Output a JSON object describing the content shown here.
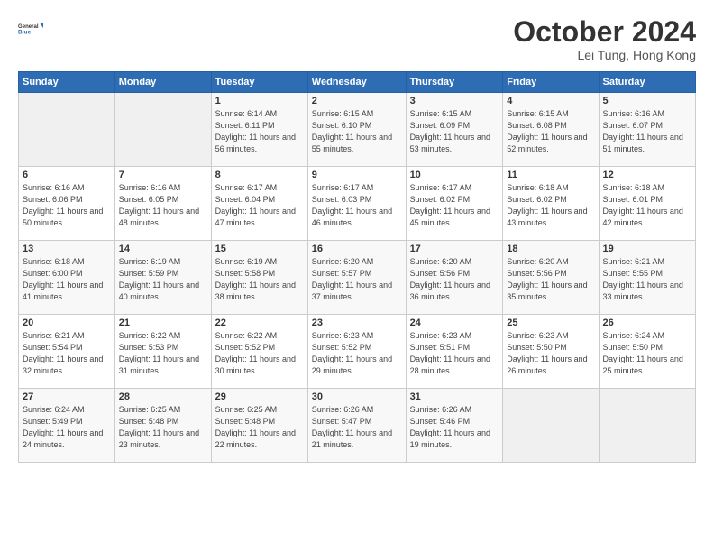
{
  "header": {
    "logo_line1": "General",
    "logo_line2": "Blue",
    "month_title": "October 2024",
    "location": "Lei Tung, Hong Kong"
  },
  "weekdays": [
    "Sunday",
    "Monday",
    "Tuesday",
    "Wednesday",
    "Thursday",
    "Friday",
    "Saturday"
  ],
  "weeks": [
    [
      {
        "day": "",
        "sunrise": "",
        "sunset": "",
        "daylight": ""
      },
      {
        "day": "",
        "sunrise": "",
        "sunset": "",
        "daylight": ""
      },
      {
        "day": "1",
        "sunrise": "Sunrise: 6:14 AM",
        "sunset": "Sunset: 6:11 PM",
        "daylight": "Daylight: 11 hours and 56 minutes."
      },
      {
        "day": "2",
        "sunrise": "Sunrise: 6:15 AM",
        "sunset": "Sunset: 6:10 PM",
        "daylight": "Daylight: 11 hours and 55 minutes."
      },
      {
        "day": "3",
        "sunrise": "Sunrise: 6:15 AM",
        "sunset": "Sunset: 6:09 PM",
        "daylight": "Daylight: 11 hours and 53 minutes."
      },
      {
        "day": "4",
        "sunrise": "Sunrise: 6:15 AM",
        "sunset": "Sunset: 6:08 PM",
        "daylight": "Daylight: 11 hours and 52 minutes."
      },
      {
        "day": "5",
        "sunrise": "Sunrise: 6:16 AM",
        "sunset": "Sunset: 6:07 PM",
        "daylight": "Daylight: 11 hours and 51 minutes."
      }
    ],
    [
      {
        "day": "6",
        "sunrise": "Sunrise: 6:16 AM",
        "sunset": "Sunset: 6:06 PM",
        "daylight": "Daylight: 11 hours and 50 minutes."
      },
      {
        "day": "7",
        "sunrise": "Sunrise: 6:16 AM",
        "sunset": "Sunset: 6:05 PM",
        "daylight": "Daylight: 11 hours and 48 minutes."
      },
      {
        "day": "8",
        "sunrise": "Sunrise: 6:17 AM",
        "sunset": "Sunset: 6:04 PM",
        "daylight": "Daylight: 11 hours and 47 minutes."
      },
      {
        "day": "9",
        "sunrise": "Sunrise: 6:17 AM",
        "sunset": "Sunset: 6:03 PM",
        "daylight": "Daylight: 11 hours and 46 minutes."
      },
      {
        "day": "10",
        "sunrise": "Sunrise: 6:17 AM",
        "sunset": "Sunset: 6:02 PM",
        "daylight": "Daylight: 11 hours and 45 minutes."
      },
      {
        "day": "11",
        "sunrise": "Sunrise: 6:18 AM",
        "sunset": "Sunset: 6:02 PM",
        "daylight": "Daylight: 11 hours and 43 minutes."
      },
      {
        "day": "12",
        "sunrise": "Sunrise: 6:18 AM",
        "sunset": "Sunset: 6:01 PM",
        "daylight": "Daylight: 11 hours and 42 minutes."
      }
    ],
    [
      {
        "day": "13",
        "sunrise": "Sunrise: 6:18 AM",
        "sunset": "Sunset: 6:00 PM",
        "daylight": "Daylight: 11 hours and 41 minutes."
      },
      {
        "day": "14",
        "sunrise": "Sunrise: 6:19 AM",
        "sunset": "Sunset: 5:59 PM",
        "daylight": "Daylight: 11 hours and 40 minutes."
      },
      {
        "day": "15",
        "sunrise": "Sunrise: 6:19 AM",
        "sunset": "Sunset: 5:58 PM",
        "daylight": "Daylight: 11 hours and 38 minutes."
      },
      {
        "day": "16",
        "sunrise": "Sunrise: 6:20 AM",
        "sunset": "Sunset: 5:57 PM",
        "daylight": "Daylight: 11 hours and 37 minutes."
      },
      {
        "day": "17",
        "sunrise": "Sunrise: 6:20 AM",
        "sunset": "Sunset: 5:56 PM",
        "daylight": "Daylight: 11 hours and 36 minutes."
      },
      {
        "day": "18",
        "sunrise": "Sunrise: 6:20 AM",
        "sunset": "Sunset: 5:56 PM",
        "daylight": "Daylight: 11 hours and 35 minutes."
      },
      {
        "day": "19",
        "sunrise": "Sunrise: 6:21 AM",
        "sunset": "Sunset: 5:55 PM",
        "daylight": "Daylight: 11 hours and 33 minutes."
      }
    ],
    [
      {
        "day": "20",
        "sunrise": "Sunrise: 6:21 AM",
        "sunset": "Sunset: 5:54 PM",
        "daylight": "Daylight: 11 hours and 32 minutes."
      },
      {
        "day": "21",
        "sunrise": "Sunrise: 6:22 AM",
        "sunset": "Sunset: 5:53 PM",
        "daylight": "Daylight: 11 hours and 31 minutes."
      },
      {
        "day": "22",
        "sunrise": "Sunrise: 6:22 AM",
        "sunset": "Sunset: 5:52 PM",
        "daylight": "Daylight: 11 hours and 30 minutes."
      },
      {
        "day": "23",
        "sunrise": "Sunrise: 6:23 AM",
        "sunset": "Sunset: 5:52 PM",
        "daylight": "Daylight: 11 hours and 29 minutes."
      },
      {
        "day": "24",
        "sunrise": "Sunrise: 6:23 AM",
        "sunset": "Sunset: 5:51 PM",
        "daylight": "Daylight: 11 hours and 28 minutes."
      },
      {
        "day": "25",
        "sunrise": "Sunrise: 6:23 AM",
        "sunset": "Sunset: 5:50 PM",
        "daylight": "Daylight: 11 hours and 26 minutes."
      },
      {
        "day": "26",
        "sunrise": "Sunrise: 6:24 AM",
        "sunset": "Sunset: 5:50 PM",
        "daylight": "Daylight: 11 hours and 25 minutes."
      }
    ],
    [
      {
        "day": "27",
        "sunrise": "Sunrise: 6:24 AM",
        "sunset": "Sunset: 5:49 PM",
        "daylight": "Daylight: 11 hours and 24 minutes."
      },
      {
        "day": "28",
        "sunrise": "Sunrise: 6:25 AM",
        "sunset": "Sunset: 5:48 PM",
        "daylight": "Daylight: 11 hours and 23 minutes."
      },
      {
        "day": "29",
        "sunrise": "Sunrise: 6:25 AM",
        "sunset": "Sunset: 5:48 PM",
        "daylight": "Daylight: 11 hours and 22 minutes."
      },
      {
        "day": "30",
        "sunrise": "Sunrise: 6:26 AM",
        "sunset": "Sunset: 5:47 PM",
        "daylight": "Daylight: 11 hours and 21 minutes."
      },
      {
        "day": "31",
        "sunrise": "Sunrise: 6:26 AM",
        "sunset": "Sunset: 5:46 PM",
        "daylight": "Daylight: 11 hours and 19 minutes."
      },
      {
        "day": "",
        "sunrise": "",
        "sunset": "",
        "daylight": ""
      },
      {
        "day": "",
        "sunrise": "",
        "sunset": "",
        "daylight": ""
      }
    ]
  ]
}
